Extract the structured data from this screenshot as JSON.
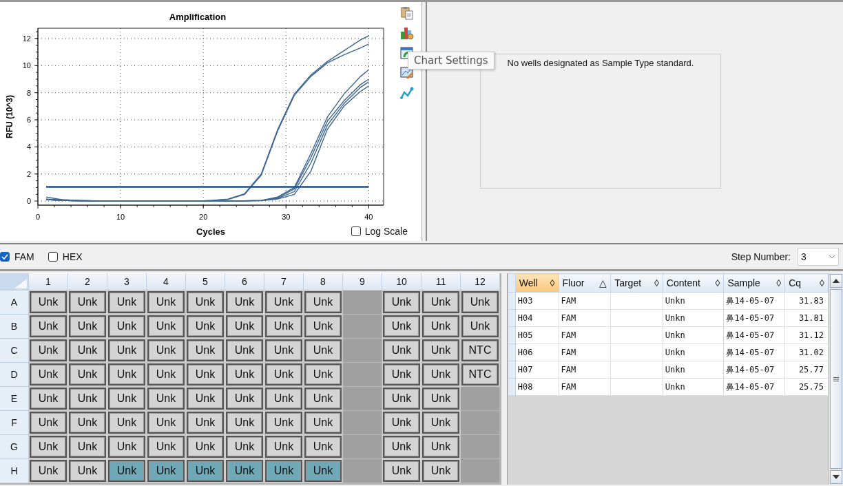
{
  "amplification": {
    "toolbar": [
      {
        "kind": "clipboard"
      },
      {
        "kind": "chart-gear"
      },
      {
        "kind": "window-arrow"
      },
      {
        "kind": "chart-pencil"
      },
      {
        "kind": "line-graph"
      }
    ],
    "tooltip": {
      "text": "Chart Settings"
    },
    "log_scale": {
      "label": "Log Scale",
      "checked": false
    },
    "chart_data": {
      "type": "line",
      "title": "Amplification",
      "xlabel": "Cycles",
      "ylabel": "RFU (10^3)",
      "xlim": [
        0,
        41.8
      ],
      "ylim": [
        -0.3,
        12.76
      ],
      "grid": true,
      "xticks": [
        0,
        10,
        20,
        30,
        40
      ],
      "yticks": [
        0,
        2,
        4,
        6,
        8,
        10,
        12
      ],
      "x": [
        1,
        3,
        5,
        7,
        9,
        11,
        13,
        15,
        17,
        19,
        21,
        23,
        25,
        27,
        29,
        31,
        33,
        35,
        37,
        39,
        40
      ],
      "series": [
        {
          "color": "#3d6591",
          "values": [
            0.3,
            0.1,
            0.05,
            0.02,
            0,
            0,
            0,
            0,
            0,
            0,
            0.05,
            0.15,
            0.55,
            2.0,
            5.3,
            7.9,
            9.3,
            10.3,
            11.1,
            11.9,
            12.2
          ]
        },
        {
          "color": "#3d6591",
          "values": [
            0.15,
            0.1,
            0.05,
            0.02,
            0,
            0,
            0,
            0,
            0,
            0,
            0.05,
            0.12,
            0.5,
            1.9,
            5.2,
            7.8,
            9.2,
            10.2,
            10.8,
            11.3,
            11.6
          ]
        },
        {
          "color": "#3d6591",
          "values": [
            0.1,
            0.05,
            0.02,
            0,
            0,
            0,
            0,
            0,
            0,
            0,
            0,
            0,
            0.02,
            0.05,
            0.3,
            1.0,
            3.5,
            6.2,
            7.9,
            9.2,
            9.7
          ]
        },
        {
          "color": "#3d6591",
          "values": [
            0.1,
            0.05,
            0.02,
            0,
            0,
            0,
            0,
            0,
            0,
            0,
            0,
            0,
            0.02,
            0.05,
            0.25,
            0.9,
            3.2,
            5.9,
            7.4,
            8.6,
            9.0
          ]
        },
        {
          "color": "#3d6591",
          "values": [
            0.1,
            0.05,
            0.02,
            0,
            0,
            0,
            0,
            0,
            0,
            0,
            0,
            0,
            0.02,
            0.04,
            0.2,
            0.7,
            2.8,
            5.6,
            7.2,
            8.4,
            8.8
          ]
        },
        {
          "color": "#3d6591",
          "values": [
            0.1,
            0.05,
            0.02,
            0,
            0,
            0,
            0,
            0,
            0,
            0,
            0,
            0,
            0.02,
            0.03,
            0.15,
            0.5,
            2.2,
            5.3,
            7.0,
            8.1,
            8.5
          ]
        },
        {
          "color": "#1b4f8a",
          "values": [
            1.05,
            1.05,
            1.05,
            1.05,
            1.05,
            1.05,
            1.05,
            1.05,
            1.05,
            1.05,
            1.05,
            1.05,
            1.05,
            1.05,
            1.05,
            1.05,
            1.05,
            1.05,
            1.05,
            1.05,
            1.05
          ]
        }
      ]
    }
  },
  "standard_curve": {
    "message": "No wells designated as Sample Type standard."
  },
  "fluorophores": [
    {
      "label": "FAM",
      "checked": true
    },
    {
      "label": "HEX",
      "checked": false
    }
  ],
  "step_number": {
    "label": "Step Number:",
    "value": "3"
  },
  "plate": {
    "columns": [
      "1",
      "2",
      "3",
      "4",
      "5",
      "6",
      "7",
      "8",
      "9",
      "10",
      "11",
      "12"
    ],
    "rows": [
      {
        "label": "A",
        "wells": [
          {
            "kind": "sample",
            "text": "Unk",
            "selected": false
          },
          {
            "kind": "sample",
            "text": "Unk",
            "selected": false
          },
          {
            "kind": "sample",
            "text": "Unk",
            "selected": false
          },
          {
            "kind": "sample",
            "text": "Unk",
            "selected": false
          },
          {
            "kind": "sample",
            "text": "Unk",
            "selected": false
          },
          {
            "kind": "sample",
            "text": "Unk",
            "selected": false
          },
          {
            "kind": "sample",
            "text": "Unk",
            "selected": false
          },
          {
            "kind": "sample",
            "text": "Unk",
            "selected": false
          },
          {
            "kind": "empty",
            "selected": false
          },
          {
            "kind": "sample",
            "text": "Unk",
            "selected": false
          },
          {
            "kind": "sample",
            "text": "Unk",
            "selected": false
          },
          {
            "kind": "sample",
            "text": "Unk",
            "selected": false
          }
        ]
      },
      {
        "label": "B",
        "wells": [
          {
            "kind": "sample",
            "text": "Unk",
            "selected": false
          },
          {
            "kind": "sample",
            "text": "Unk",
            "selected": false
          },
          {
            "kind": "sample",
            "text": "Unk",
            "selected": false
          },
          {
            "kind": "sample",
            "text": "Unk",
            "selected": false
          },
          {
            "kind": "sample",
            "text": "Unk",
            "selected": false
          },
          {
            "kind": "sample",
            "text": "Unk",
            "selected": false
          },
          {
            "kind": "sample",
            "text": "Unk",
            "selected": false
          },
          {
            "kind": "sample",
            "text": "Unk",
            "selected": false
          },
          {
            "kind": "empty",
            "selected": false
          },
          {
            "kind": "sample",
            "text": "Unk",
            "selected": false
          },
          {
            "kind": "sample",
            "text": "Unk",
            "selected": false
          },
          {
            "kind": "sample",
            "text": "Unk",
            "selected": false
          }
        ]
      },
      {
        "label": "C",
        "wells": [
          {
            "kind": "sample",
            "text": "Unk",
            "selected": false
          },
          {
            "kind": "sample",
            "text": "Unk",
            "selected": false
          },
          {
            "kind": "sample",
            "text": "Unk",
            "selected": false
          },
          {
            "kind": "sample",
            "text": "Unk",
            "selected": false
          },
          {
            "kind": "sample",
            "text": "Unk",
            "selected": false
          },
          {
            "kind": "sample",
            "text": "Unk",
            "selected": false
          },
          {
            "kind": "sample",
            "text": "Unk",
            "selected": false
          },
          {
            "kind": "sample",
            "text": "Unk",
            "selected": false
          },
          {
            "kind": "empty",
            "selected": false
          },
          {
            "kind": "sample",
            "text": "Unk",
            "selected": false
          },
          {
            "kind": "sample",
            "text": "Unk",
            "selected": false
          },
          {
            "kind": "sample",
            "text": "NTC",
            "selected": false
          }
        ]
      },
      {
        "label": "D",
        "wells": [
          {
            "kind": "sample",
            "text": "Unk",
            "selected": false
          },
          {
            "kind": "sample",
            "text": "Unk",
            "selected": false
          },
          {
            "kind": "sample",
            "text": "Unk",
            "selected": false
          },
          {
            "kind": "sample",
            "text": "Unk",
            "selected": false
          },
          {
            "kind": "sample",
            "text": "Unk",
            "selected": false
          },
          {
            "kind": "sample",
            "text": "Unk",
            "selected": false
          },
          {
            "kind": "sample",
            "text": "Unk",
            "selected": false
          },
          {
            "kind": "sample",
            "text": "Unk",
            "selected": false
          },
          {
            "kind": "empty",
            "selected": false
          },
          {
            "kind": "sample",
            "text": "Unk",
            "selected": false
          },
          {
            "kind": "sample",
            "text": "Unk",
            "selected": false
          },
          {
            "kind": "sample",
            "text": "NTC",
            "selected": false
          }
        ]
      },
      {
        "label": "E",
        "wells": [
          {
            "kind": "sample",
            "text": "Unk",
            "selected": false
          },
          {
            "kind": "sample",
            "text": "Unk",
            "selected": false
          },
          {
            "kind": "sample",
            "text": "Unk",
            "selected": false
          },
          {
            "kind": "sample",
            "text": "Unk",
            "selected": false
          },
          {
            "kind": "sample",
            "text": "Unk",
            "selected": false
          },
          {
            "kind": "sample",
            "text": "Unk",
            "selected": false
          },
          {
            "kind": "sample",
            "text": "Unk",
            "selected": false
          },
          {
            "kind": "sample",
            "text": "Unk",
            "selected": false
          },
          {
            "kind": "empty",
            "selected": false
          },
          {
            "kind": "sample",
            "text": "Unk",
            "selected": false
          },
          {
            "kind": "sample",
            "text": "Unk",
            "selected": false
          },
          {
            "kind": "empty",
            "selected": false
          }
        ]
      },
      {
        "label": "F",
        "wells": [
          {
            "kind": "sample",
            "text": "Unk",
            "selected": false
          },
          {
            "kind": "sample",
            "text": "Unk",
            "selected": false
          },
          {
            "kind": "sample",
            "text": "Unk",
            "selected": false
          },
          {
            "kind": "sample",
            "text": "Unk",
            "selected": false
          },
          {
            "kind": "sample",
            "text": "Unk",
            "selected": false
          },
          {
            "kind": "sample",
            "text": "Unk",
            "selected": false
          },
          {
            "kind": "sample",
            "text": "Unk",
            "selected": false
          },
          {
            "kind": "sample",
            "text": "Unk",
            "selected": false
          },
          {
            "kind": "empty",
            "selected": false
          },
          {
            "kind": "sample",
            "text": "Unk",
            "selected": false
          },
          {
            "kind": "sample",
            "text": "Unk",
            "selected": false
          },
          {
            "kind": "empty",
            "selected": false
          }
        ]
      },
      {
        "label": "G",
        "wells": [
          {
            "kind": "sample",
            "text": "Unk",
            "selected": false
          },
          {
            "kind": "sample",
            "text": "Unk",
            "selected": false
          },
          {
            "kind": "sample",
            "text": "Unk",
            "selected": false
          },
          {
            "kind": "sample",
            "text": "Unk",
            "selected": false
          },
          {
            "kind": "sample",
            "text": "Unk",
            "selected": false
          },
          {
            "kind": "sample",
            "text": "Unk",
            "selected": false
          },
          {
            "kind": "sample",
            "text": "Unk",
            "selected": false
          },
          {
            "kind": "sample",
            "text": "Unk",
            "selected": false
          },
          {
            "kind": "empty",
            "selected": false
          },
          {
            "kind": "sample",
            "text": "Unk",
            "selected": false
          },
          {
            "kind": "sample",
            "text": "Unk",
            "selected": false
          },
          {
            "kind": "empty",
            "selected": false
          }
        ]
      },
      {
        "label": "H",
        "wells": [
          {
            "kind": "sample",
            "text": "Unk",
            "selected": false
          },
          {
            "kind": "sample",
            "text": "Unk",
            "selected": false
          },
          {
            "kind": "sample",
            "text": "Unk",
            "selected": true
          },
          {
            "kind": "sample",
            "text": "Unk",
            "selected": true
          },
          {
            "kind": "sample",
            "text": "Unk",
            "selected": true
          },
          {
            "kind": "sample",
            "text": "Unk",
            "selected": true
          },
          {
            "kind": "sample",
            "text": "Unk",
            "selected": true
          },
          {
            "kind": "sample",
            "text": "Unk",
            "selected": true
          },
          {
            "kind": "empty",
            "selected": false
          },
          {
            "kind": "sample",
            "text": "Unk",
            "selected": false
          },
          {
            "kind": "sample",
            "text": "Unk",
            "selected": false
          },
          {
            "kind": "empty",
            "selected": false
          }
        ]
      }
    ]
  },
  "table": {
    "columns": [
      {
        "label": "Well",
        "sort": "◊",
        "active": true
      },
      {
        "label": "Fluor",
        "sort": "△",
        "active": false
      },
      {
        "label": "Target",
        "sort": "◊",
        "active": false
      },
      {
        "label": "Content",
        "sort": "◊",
        "active": false
      },
      {
        "label": "Sample",
        "sort": "◊",
        "active": false
      },
      {
        "label": "Cq",
        "sort": "◊",
        "active": false
      }
    ],
    "rows": [
      [
        "H03",
        "FAM",
        "",
        "Unkn",
        "鼻14-05-07",
        "31.83"
      ],
      [
        "H04",
        "FAM",
        "",
        "Unkn",
        "鼻14-05-07",
        "31.81"
      ],
      [
        "H05",
        "FAM",
        "",
        "Unkn",
        "鼻14-05-07",
        "31.12"
      ],
      [
        "H06",
        "FAM",
        "",
        "Unkn",
        "鼻14-05-07",
        "31.02"
      ],
      [
        "H07",
        "FAM",
        "",
        "Unkn",
        "鼻14-05-07",
        "25.77"
      ],
      [
        "H08",
        "FAM",
        "",
        "Unkn",
        "鼻14-05-07",
        "25.75"
      ]
    ]
  }
}
